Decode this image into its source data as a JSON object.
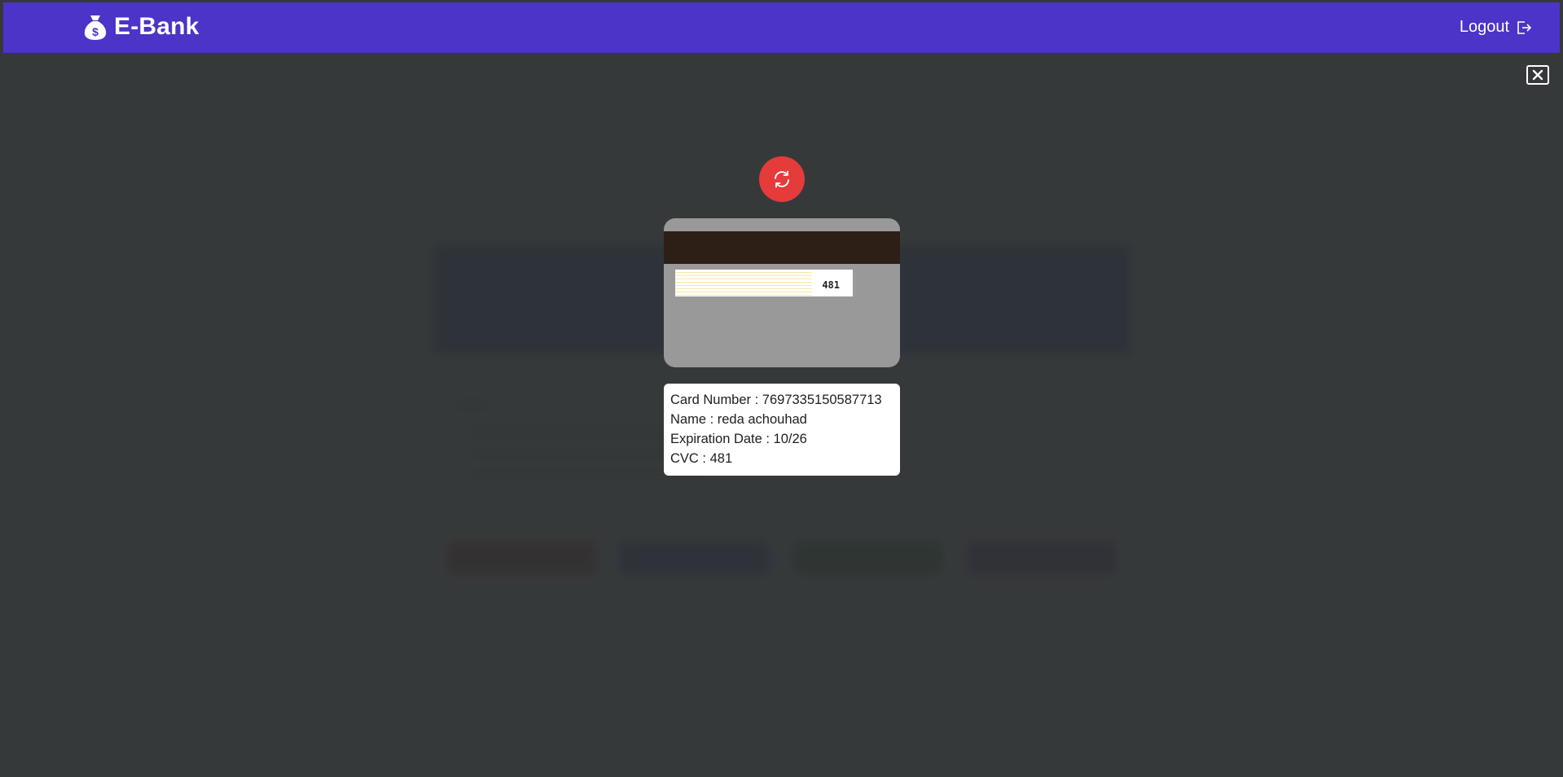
{
  "header": {
    "brand_name": "E-Bank",
    "brand_icon": "money-bag-icon",
    "logout_label": "Logout",
    "logout_icon": "sign-out-icon"
  },
  "modal": {
    "close_icon": "close-icon",
    "flip_icon": "refresh-icon",
    "card_back": {
      "cvc": "481"
    },
    "details": {
      "card_number": "Card Number : 7697335150587713",
      "name": "Name : reda achouhad",
      "expiration": "Expiration Date : 10/26",
      "cvc": "CVC : 481"
    }
  },
  "colors": {
    "header_bg": "#4b34c7",
    "flip_button": "#e53b3b",
    "card_bg": "#999999",
    "magnetic_stripe": "#2d1e16",
    "overlay": "#303334"
  }
}
